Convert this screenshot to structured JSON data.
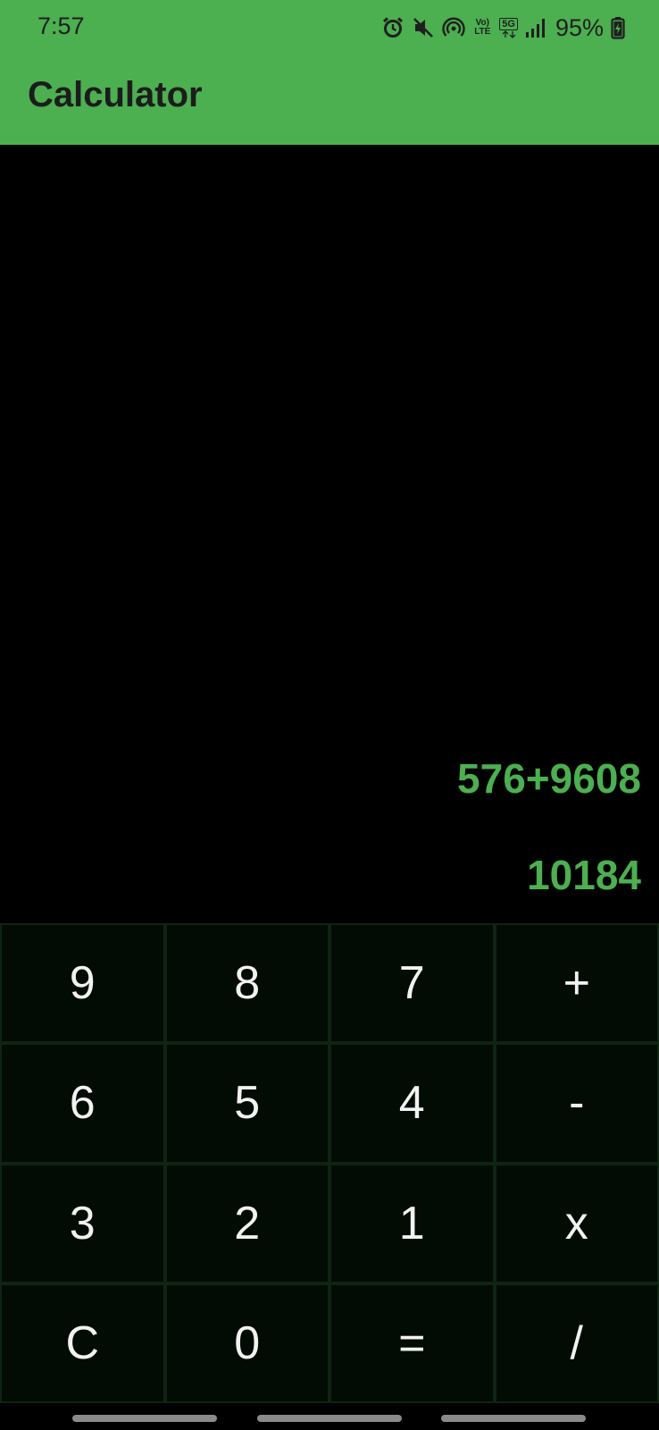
{
  "status_bar": {
    "time": "7:57",
    "battery": "95%",
    "network": "5G",
    "volte": "Vo) LTE",
    "icons": [
      "alarm-icon",
      "mute-icon",
      "hotspot-icon",
      "volte-icon",
      "network-5g-icon",
      "signal-icon",
      "battery-charging-icon"
    ]
  },
  "app_bar": {
    "title": "Calculator"
  },
  "display": {
    "expression": "576+9608",
    "result": "10184"
  },
  "keypad": {
    "keys": [
      {
        "label": "9",
        "name": "key-9"
      },
      {
        "label": "8",
        "name": "key-8"
      },
      {
        "label": "7",
        "name": "key-7"
      },
      {
        "label": "+",
        "name": "key-plus"
      },
      {
        "label": "6",
        "name": "key-6"
      },
      {
        "label": "5",
        "name": "key-5"
      },
      {
        "label": "4",
        "name": "key-4"
      },
      {
        "label": "-",
        "name": "key-minus"
      },
      {
        "label": "3",
        "name": "key-3"
      },
      {
        "label": "2",
        "name": "key-2"
      },
      {
        "label": "1",
        "name": "key-1"
      },
      {
        "label": "x",
        "name": "key-multiply"
      },
      {
        "label": "C",
        "name": "key-clear"
      },
      {
        "label": "0",
        "name": "key-0"
      },
      {
        "label": "=",
        "name": "key-equals"
      },
      {
        "label": "/",
        "name": "key-divide"
      }
    ]
  },
  "colors": {
    "accent": "#4caf50",
    "background": "#000000",
    "key_background": "#030b05",
    "key_text": "#f2f2f2"
  }
}
